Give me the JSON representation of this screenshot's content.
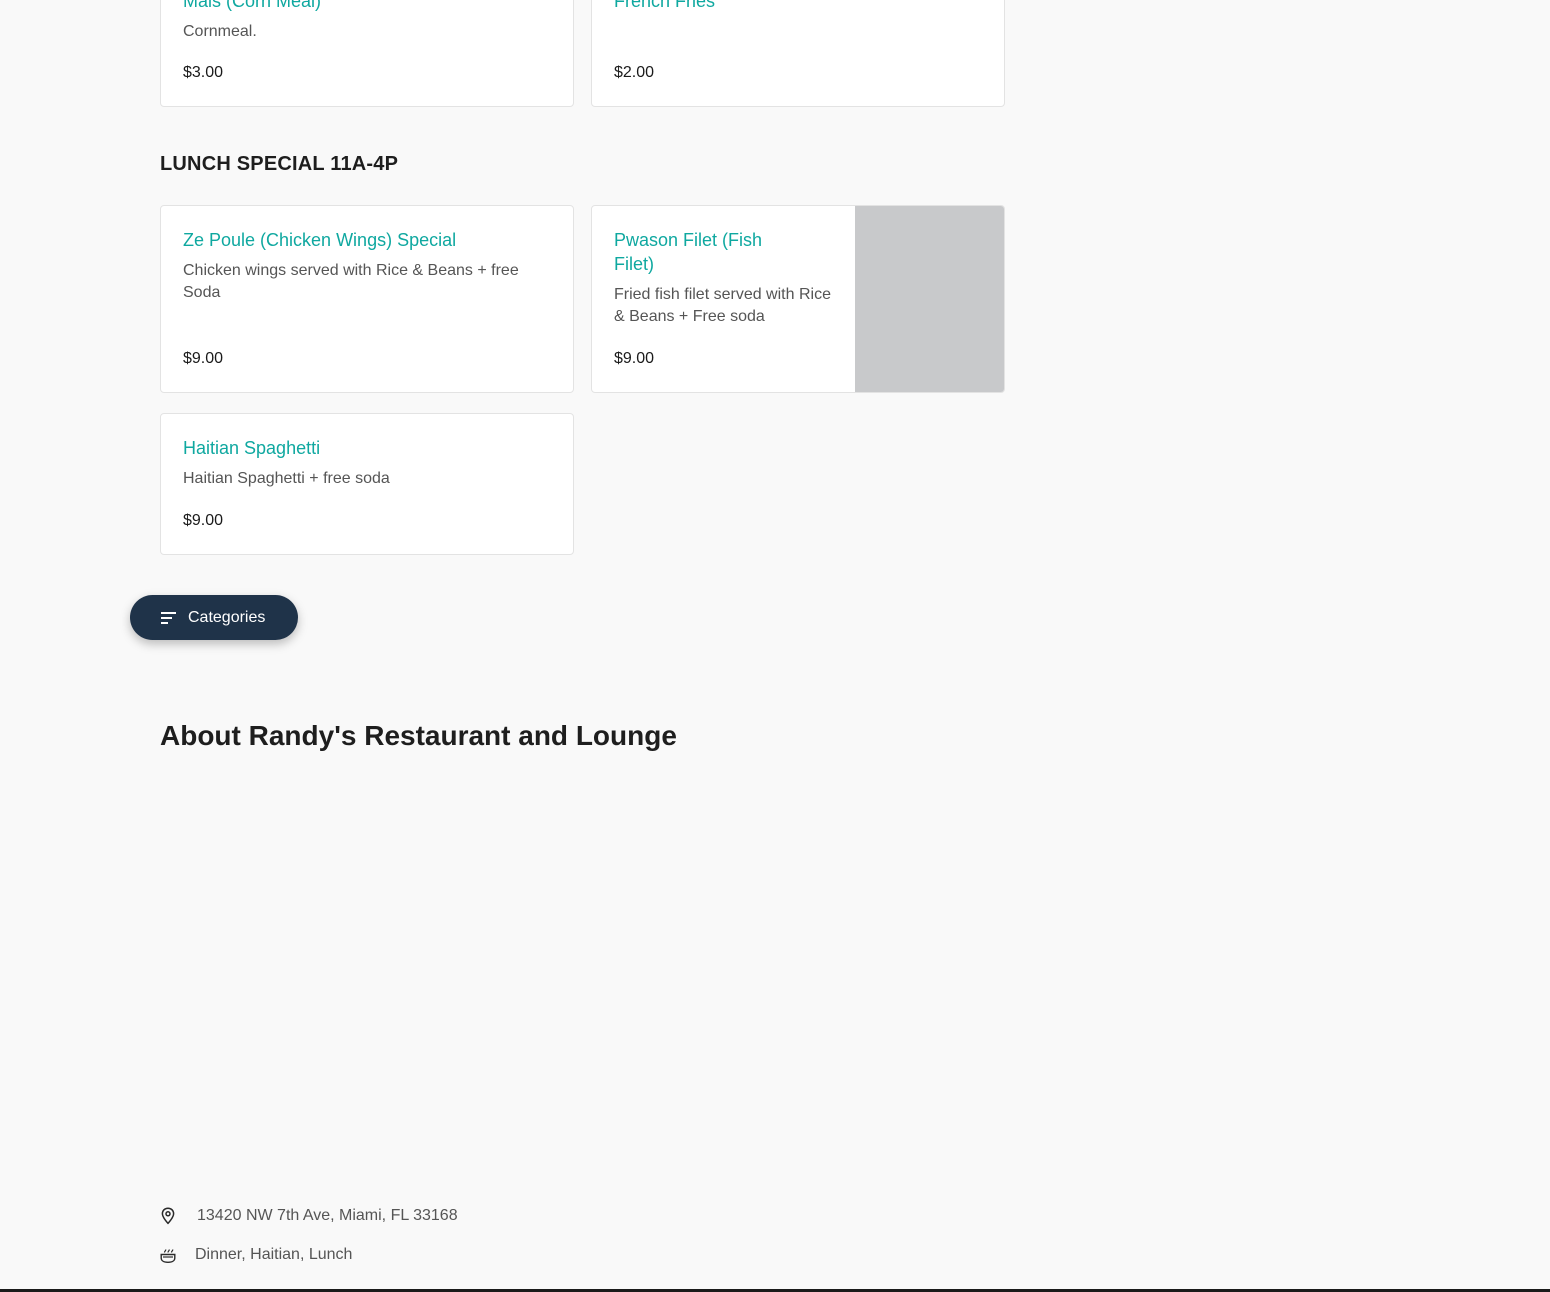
{
  "menu": {
    "top_items": [
      {
        "name": "Mais (Corn Meal)",
        "description": "Cornmeal.",
        "price": "$3.00"
      },
      {
        "name": "French Fries",
        "description": "",
        "price": "$2.00"
      }
    ],
    "lunch_special": {
      "title": "LUNCH SPECIAL 11A-4P",
      "items": [
        {
          "name": "Ze Poule (Chicken Wings) Special",
          "description": "Chicken wings served with Rice & Beans + free Soda",
          "price": "$9.00"
        },
        {
          "name": "Pwason Filet (Fish Filet)",
          "description": "Fried fish filet served with Rice & Beans + Free soda",
          "price": "$9.00"
        },
        {
          "name": "Haitian Spaghetti",
          "description": "Haitian Spaghetti + free soda",
          "price": "$9.00"
        }
      ]
    }
  },
  "categories_button": {
    "label": "Categories",
    "icon": "sort-lines-icon"
  },
  "about": {
    "title": "About Randy's Restaurant and Lounge",
    "address": "13420 NW 7th Ave, Miami, FL 33168",
    "cuisines": "Dinner, Haitian, Lunch"
  },
  "colors": {
    "accent": "#0fa8a0",
    "button_bg": "#1f3349",
    "page_bg": "#f9f9f9",
    "image_placeholder": "#c8c9cb"
  }
}
